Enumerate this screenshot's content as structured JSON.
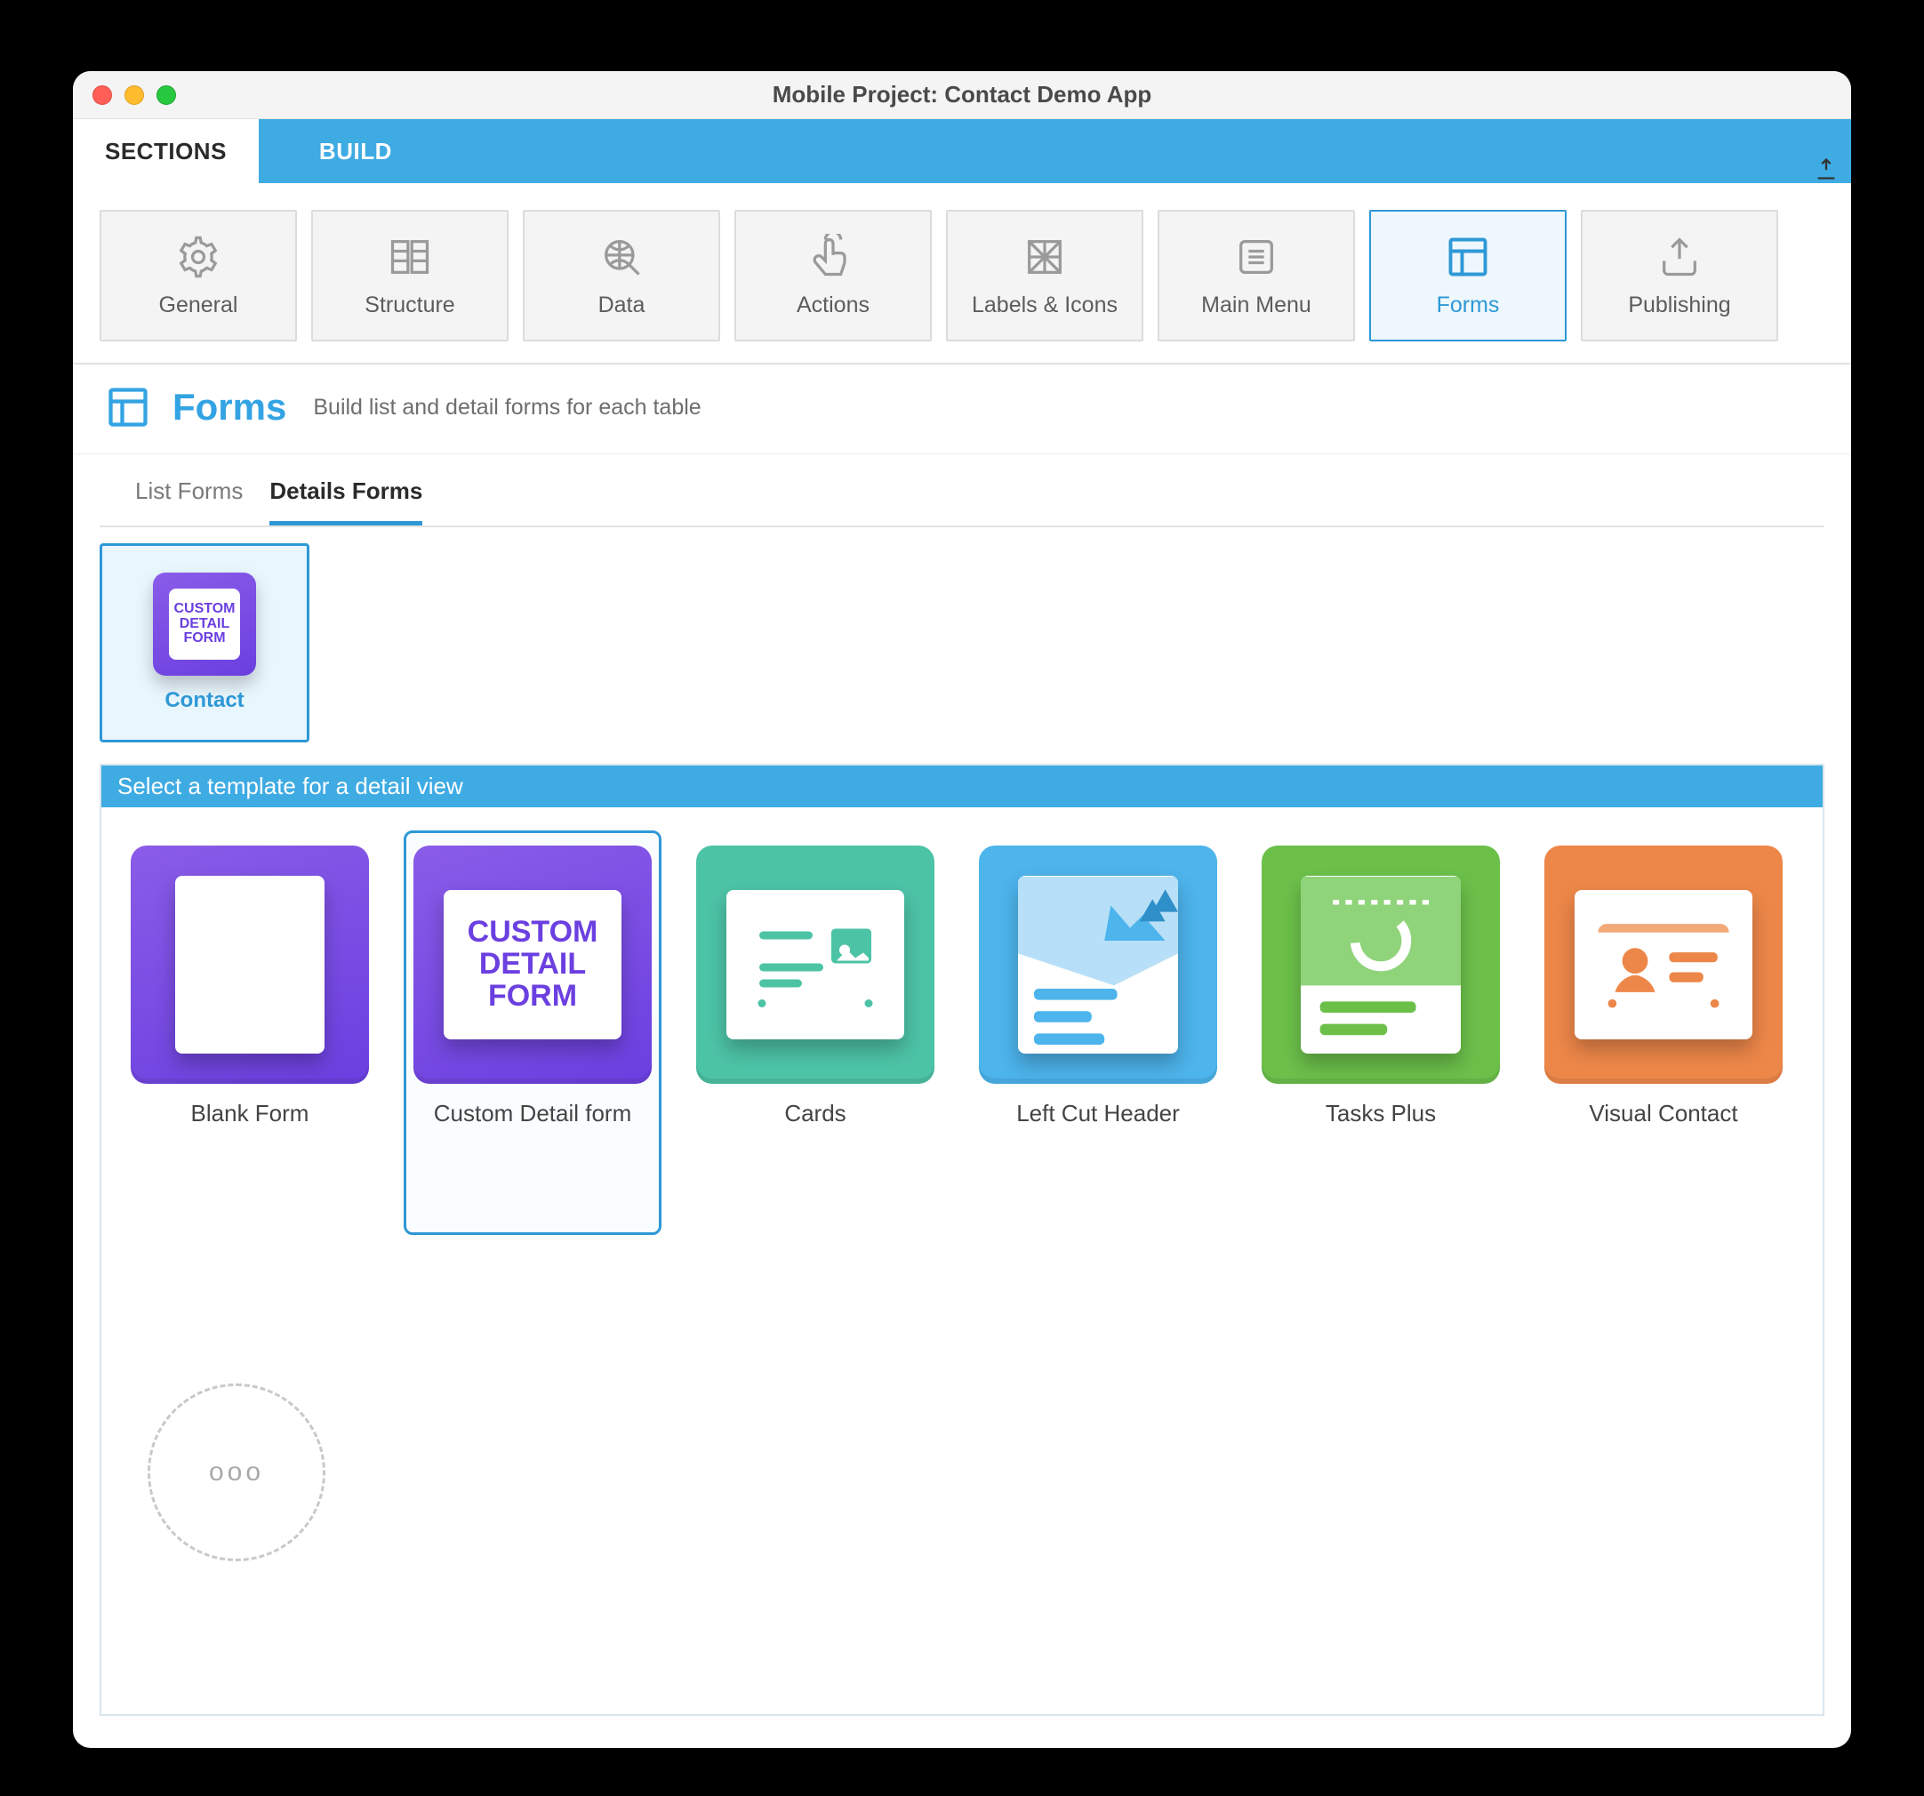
{
  "window": {
    "title": "Mobile Project: Contact Demo App"
  },
  "topTabs": {
    "sections": "SECTIONS",
    "build": "BUILD"
  },
  "nav": [
    {
      "label": "General"
    },
    {
      "label": "Structure"
    },
    {
      "label": "Data"
    },
    {
      "label": "Actions"
    },
    {
      "label": "Labels & Icons"
    },
    {
      "label": "Main Menu"
    },
    {
      "label": "Forms"
    },
    {
      "label": "Publishing"
    }
  ],
  "formsHeader": {
    "title": "Forms",
    "subtitle": "Build list and detail forms for each table"
  },
  "subTabs": {
    "list": "List Forms",
    "details": "Details Forms"
  },
  "tables": [
    {
      "label": "Contact",
      "thumbText": "CUSTOM\nDETAIL\nFORM"
    }
  ],
  "templatePanel": {
    "header": "Select a template for a detail view"
  },
  "templates": [
    {
      "label": "Blank Form"
    },
    {
      "label": "Custom Detail form",
      "text": "CUSTOM\nDETAIL\nFORM"
    },
    {
      "label": "Cards"
    },
    {
      "label": "Left Cut Header"
    },
    {
      "label": "Tasks Plus"
    },
    {
      "label": "Visual Contact"
    }
  ]
}
